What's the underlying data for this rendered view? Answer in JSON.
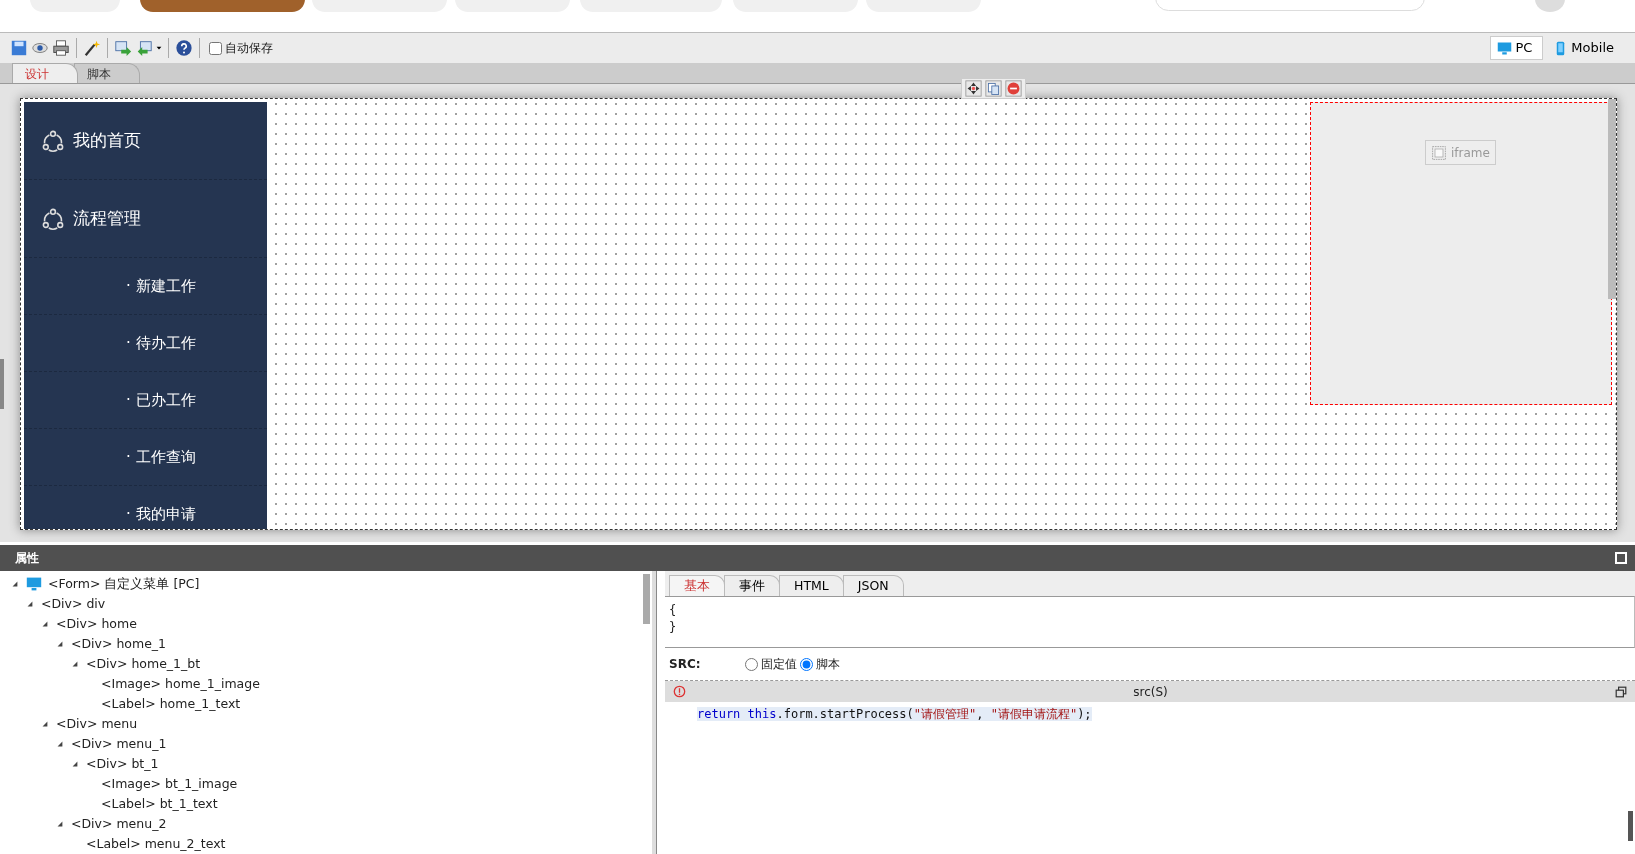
{
  "browser_tabs": [
    {
      "selected": false
    },
    {
      "selected": true
    },
    {
      "selected": false
    },
    {
      "selected": false
    },
    {
      "selected": false
    },
    {
      "selected": false
    },
    {
      "selected": false
    }
  ],
  "toolbar": {
    "autosave": {
      "label": "自动保存",
      "checked": false
    },
    "devices": [
      {
        "label": "PC",
        "kind": "pc",
        "selected": true
      },
      {
        "label": "Mobile",
        "kind": "mobile",
        "selected": false
      }
    ]
  },
  "design_tabs": [
    {
      "label": "设计",
      "selected": true
    },
    {
      "label": "脚本",
      "selected": false
    }
  ],
  "canvas": {
    "sidebar": {
      "headers": [
        {
          "label": "我的首页"
        },
        {
          "label": "流程管理"
        }
      ],
      "items": [
        {
          "label": "· 新建工作"
        },
        {
          "label": "· 待办工作"
        },
        {
          "label": "· 已办工作"
        },
        {
          "label": "· 工作查询"
        },
        {
          "label": "· 我的申请"
        }
      ]
    },
    "iframe": {
      "label": "iframe"
    }
  },
  "properties": {
    "title": "属性",
    "tree": [
      {
        "label": "<Form> 自定义菜单 [PC]",
        "kind": "form",
        "expanded": true,
        "children": [
          {
            "label": "<Div> div",
            "expanded": true,
            "children": [
              {
                "label": "<Div> home",
                "expanded": true,
                "children": [
                  {
                    "label": "<Div> home_1",
                    "expanded": true,
                    "children": [
                      {
                        "label": "<Div> home_1_bt",
                        "expanded": true,
                        "children": [
                          {
                            "label": "<Image> home_1_image"
                          },
                          {
                            "label": "<Label> home_1_text"
                          }
                        ]
                      }
                    ]
                  }
                ]
              },
              {
                "label": "<Div> menu",
                "expanded": true,
                "children": [
                  {
                    "label": "<Div> menu_1",
                    "expanded": true,
                    "children": [
                      {
                        "label": "<Div> bt_1",
                        "expanded": true,
                        "children": [
                          {
                            "label": "<Image> bt_1_image"
                          },
                          {
                            "label": "<Label> bt_1_text"
                          }
                        ]
                      }
                    ]
                  },
                  {
                    "label": "<Div> menu_2",
                    "expanded": true,
                    "children": [
                      {
                        "label": "<Label> menu_2_text"
                      }
                    ]
                  }
                ]
              }
            ]
          }
        ]
      }
    ],
    "tabs": [
      {
        "label": "基本",
        "selected": true
      },
      {
        "label": "事件",
        "selected": false
      },
      {
        "label": "HTML",
        "selected": false
      },
      {
        "label": "JSON",
        "selected": false
      }
    ],
    "json_lines": [
      "{",
      "}"
    ],
    "src": {
      "label": "SRC:",
      "options": [
        {
          "label": "固定值",
          "selected": false
        },
        {
          "label": "脚本",
          "selected": true
        }
      ]
    },
    "editor": {
      "title": "src(S)",
      "code": [
        {
          "kind": "keyword",
          "text": "return "
        },
        {
          "kind": "keyword",
          "text": "this"
        },
        {
          "kind": "plain",
          "text": ".form.startProcess("
        },
        {
          "kind": "string",
          "text": "\"请假管理\""
        },
        {
          "kind": "plain",
          "text": ", "
        },
        {
          "kind": "string",
          "text": "\"请假申请流程\""
        },
        {
          "kind": "plain",
          "text": ");"
        }
      ]
    }
  }
}
